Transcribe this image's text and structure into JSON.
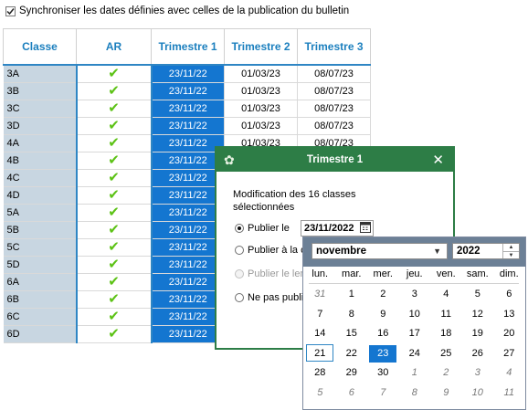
{
  "sync": {
    "checked": true,
    "label": "Synchroniser les dates définies avec celles de la publication du bulletin"
  },
  "grid": {
    "headers": [
      "Classe",
      "AR",
      "Trimestre 1",
      "Trimestre 2",
      "Trimestre 3"
    ],
    "rows": [
      {
        "classe": "3A",
        "t1": "23/11/22",
        "t2": "01/03/23",
        "t3": "08/07/23"
      },
      {
        "classe": "3B",
        "t1": "23/11/22",
        "t2": "01/03/23",
        "t3": "08/07/23"
      },
      {
        "classe": "3C",
        "t1": "23/11/22",
        "t2": "01/03/23",
        "t3": "08/07/23"
      },
      {
        "classe": "3D",
        "t1": "23/11/22",
        "t2": "01/03/23",
        "t3": "08/07/23"
      },
      {
        "classe": "4A",
        "t1": "23/11/22",
        "t2": "01/03/23",
        "t3": "08/07/23"
      },
      {
        "classe": "4B",
        "t1": "23/11/22",
        "t2": "",
        "t3": ""
      },
      {
        "classe": "4C",
        "t1": "23/11/22",
        "t2": "",
        "t3": ""
      },
      {
        "classe": "4D",
        "t1": "23/11/22",
        "t2": "",
        "t3": ""
      },
      {
        "classe": "5A",
        "t1": "23/11/22",
        "t2": "",
        "t3": ""
      },
      {
        "classe": "5B",
        "t1": "23/11/22",
        "t2": "",
        "t3": ""
      },
      {
        "classe": "5C",
        "t1": "23/11/22",
        "t2": "",
        "t3": ""
      },
      {
        "classe": "5D",
        "t1": "23/11/22",
        "t2": "",
        "t3": ""
      },
      {
        "classe": "6A",
        "t1": "23/11/22",
        "t2": "",
        "t3": ""
      },
      {
        "classe": "6B",
        "t1": "23/11/22",
        "t2": "",
        "t3": ""
      },
      {
        "classe": "6C",
        "t1": "23/11/22",
        "t2": "",
        "t3": ""
      },
      {
        "classe": "6D",
        "t1": "23/11/22",
        "t2": "",
        "t3": ""
      }
    ],
    "check_icon": "checkmark-icon",
    "colors": {
      "header_text": "#1b7fbe",
      "selected": "#1476d0",
      "class_col": "#c8d6e1",
      "check": "#5cc215"
    }
  },
  "dialog": {
    "title": "Trimestre 1",
    "message": "Modification des 16 classes sélectionnées",
    "options": [
      {
        "label": "Publier le",
        "selected": true,
        "disabled": false
      },
      {
        "label": "Publier à la c",
        "selected": false,
        "disabled": false
      },
      {
        "label": "Publier le len",
        "selected": false,
        "disabled": true
      },
      {
        "label": "Ne pas publi",
        "selected": false,
        "disabled": false
      }
    ],
    "date_value": "23/11/2022",
    "title_bar_color": "#2d7d46",
    "logo_icon": "app-logo-icon",
    "close_icon": "close-icon",
    "calendar_icon": "calendar-icon"
  },
  "calendar": {
    "month": "novembre",
    "year": "2022",
    "weekdays": [
      "lun.",
      "mar.",
      "mer.",
      "jeu.",
      "ven.",
      "sam.",
      "dim."
    ],
    "weeks": [
      [
        {
          "d": "31",
          "o": true
        },
        {
          "d": "1"
        },
        {
          "d": "2"
        },
        {
          "d": "3"
        },
        {
          "d": "4"
        },
        {
          "d": "5"
        },
        {
          "d": "6"
        }
      ],
      [
        {
          "d": "7"
        },
        {
          "d": "8"
        },
        {
          "d": "9"
        },
        {
          "d": "10"
        },
        {
          "d": "11"
        },
        {
          "d": "12"
        },
        {
          "d": "13"
        }
      ],
      [
        {
          "d": "14"
        },
        {
          "d": "15"
        },
        {
          "d": "16"
        },
        {
          "d": "17"
        },
        {
          "d": "18"
        },
        {
          "d": "19"
        },
        {
          "d": "20"
        }
      ],
      [
        {
          "d": "21",
          "today": true
        },
        {
          "d": "22"
        },
        {
          "d": "23",
          "sel": true
        },
        {
          "d": "24"
        },
        {
          "d": "25"
        },
        {
          "d": "26"
        },
        {
          "d": "27"
        }
      ],
      [
        {
          "d": "28"
        },
        {
          "d": "29"
        },
        {
          "d": "30"
        },
        {
          "d": "1",
          "o": true
        },
        {
          "d": "2",
          "o": true
        },
        {
          "d": "3",
          "o": true
        },
        {
          "d": "4",
          "o": true
        }
      ],
      [
        {
          "d": "5",
          "o": true
        },
        {
          "d": "6",
          "o": true
        },
        {
          "d": "7",
          "o": true
        },
        {
          "d": "8",
          "o": true
        },
        {
          "d": "9",
          "o": true
        },
        {
          "d": "10",
          "o": true
        },
        {
          "d": "11",
          "o": true
        }
      ]
    ],
    "header_color": "#6c8096"
  }
}
